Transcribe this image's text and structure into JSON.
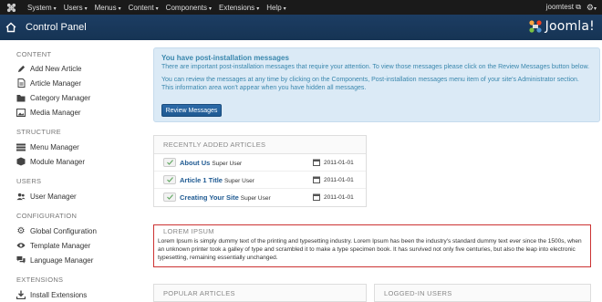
{
  "topbar": {
    "menu": [
      {
        "label": "System"
      },
      {
        "label": "Users"
      },
      {
        "label": "Menus"
      },
      {
        "label": "Content"
      },
      {
        "label": "Components"
      },
      {
        "label": "Extensions"
      },
      {
        "label": "Help"
      }
    ],
    "user": "joomtest"
  },
  "header": {
    "title": "Control Panel",
    "brand": "Joomla!"
  },
  "sidebar": {
    "sections": [
      {
        "title": "CONTENT",
        "items": [
          {
            "label": "Add New Article",
            "icon": "pencil-icon"
          },
          {
            "label": "Article Manager",
            "icon": "file-icon"
          },
          {
            "label": "Category Manager",
            "icon": "folder-icon"
          },
          {
            "label": "Media Manager",
            "icon": "image-icon"
          }
        ]
      },
      {
        "title": "STRUCTURE",
        "items": [
          {
            "label": "Menu Manager",
            "icon": "list-icon"
          },
          {
            "label": "Module Manager",
            "icon": "cube-icon"
          }
        ]
      },
      {
        "title": "USERS",
        "items": [
          {
            "label": "User Manager",
            "icon": "users-icon"
          }
        ]
      },
      {
        "title": "CONFIGURATION",
        "items": [
          {
            "label": "Global Configuration",
            "icon": "cog-icon"
          },
          {
            "label": "Template Manager",
            "icon": "eye-icon"
          },
          {
            "label": "Language Manager",
            "icon": "comments-icon"
          }
        ]
      },
      {
        "title": "EXTENSIONS",
        "items": [
          {
            "label": "Install Extensions",
            "icon": "download-icon"
          }
        ]
      }
    ]
  },
  "message": {
    "title": "You have post-installation messages",
    "text1": "There are important post-installation messages that require your attention. To view those messages please click on the Review Messages button below.",
    "text2": "You can review the messages at any time by clicking on the Components, Post-installation messages menu item of your site's Administrator section. This information area won't appear when you have hidden all messages.",
    "button": "Review Messages"
  },
  "recent": {
    "heading": "RECENTLY ADDED ARTICLES",
    "rows": [
      {
        "title": "About Us",
        "author": "Super User",
        "date": "2011-01-01"
      },
      {
        "title": "Article 1 Title",
        "author": "Super User",
        "date": "2011-01-01"
      },
      {
        "title": "Creating Your Site",
        "author": "Super User",
        "date": "2011-01-01"
      }
    ]
  },
  "lorem": {
    "title": "LOREM IPSUM",
    "text": "Lorem Ipsum is simply dummy text of the printing and typesetting industry. Lorem Ipsum has been the industry's standard dummy text ever since the 1500s, when an unknown printer took a galley of type and scrambled it to make a type specimen book. It has survived not only five centuries, but also the leap into electronic typesetting, remaining essentially unchanged."
  },
  "popular": {
    "heading": "POPULAR ARTICLES"
  },
  "logged": {
    "heading": "LOGGED-IN USERS"
  },
  "colors": {
    "header_bg": "#163454",
    "topbar_bg": "#1a1a1a",
    "accent": "#1f5a92",
    "message_bg": "#dbeaf6",
    "highlight_border": "#cc3333"
  }
}
